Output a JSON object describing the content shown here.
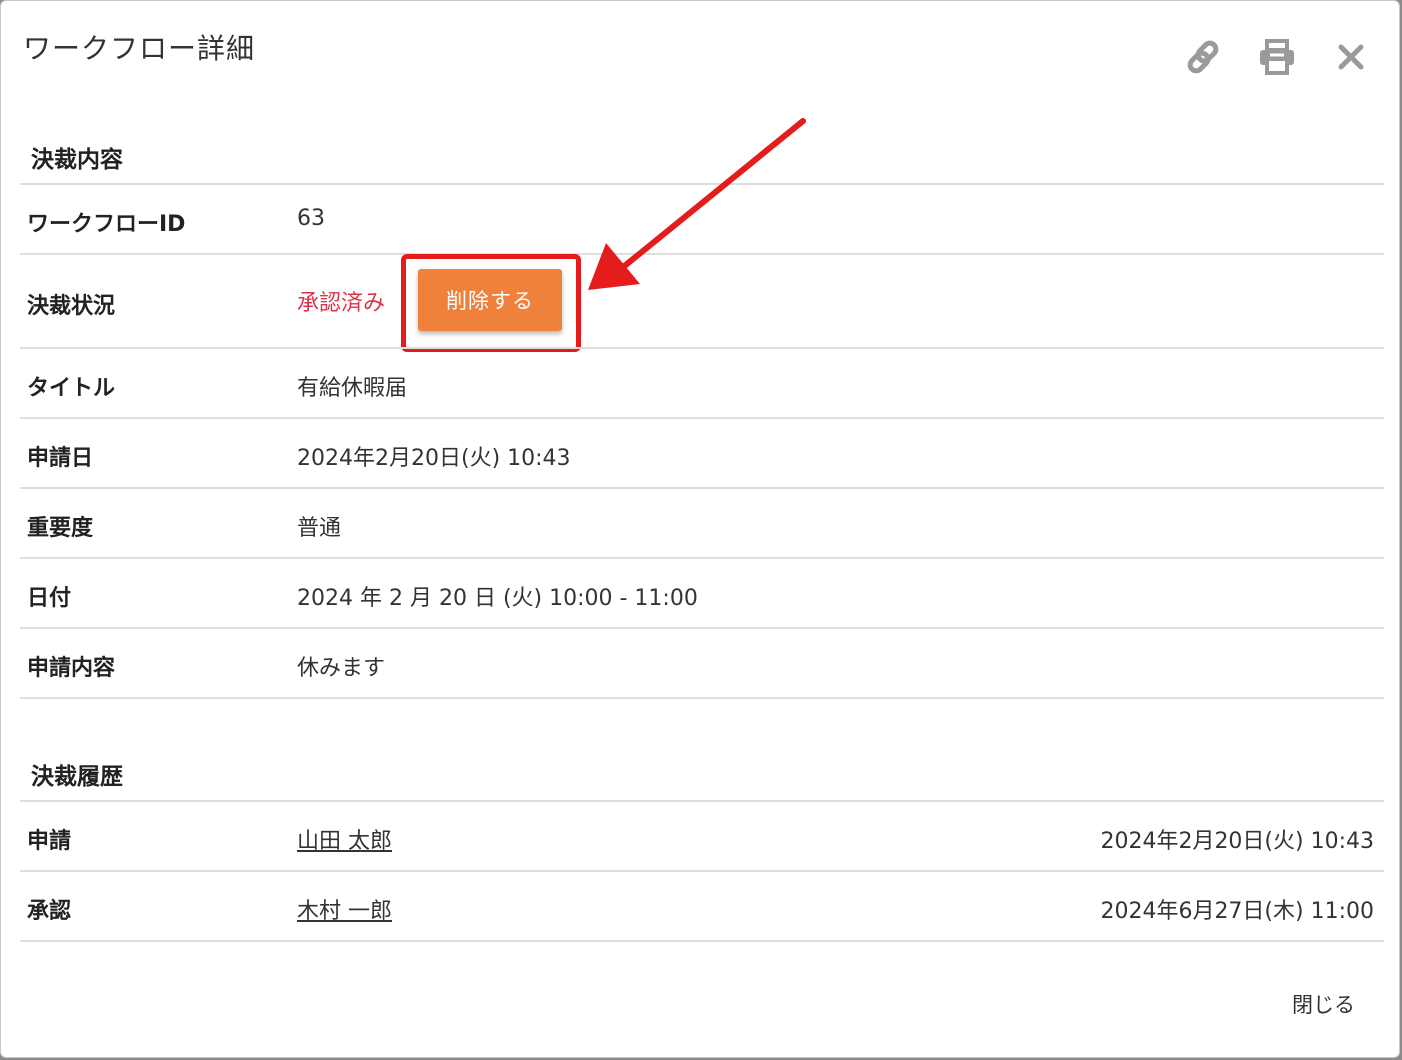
{
  "dialog": {
    "title": "ワークフロー詳細",
    "header_icons": [
      "link-icon",
      "print-icon",
      "close-icon"
    ]
  },
  "details_section": {
    "heading": "決裁内容",
    "rows": {
      "workflow_id": {
        "label": "ワークフローID",
        "value": "63"
      },
      "status": {
        "label": "決裁状況",
        "value": "承認済み",
        "delete_button": "削除する"
      },
      "title": {
        "label": "タイトル",
        "value": "有給休暇届"
      },
      "applied_date": {
        "label": "申請日",
        "value": "2024年2月20日(火) 10:43"
      },
      "importance": {
        "label": "重要度",
        "value": "普通"
      },
      "date": {
        "label": "日付",
        "value": "2024 年 2 月 20 日 (火) 10:00 - 11:00"
      },
      "content": {
        "label": "申請内容",
        "value": "休みます"
      }
    }
  },
  "history_section": {
    "heading": "決裁履歴",
    "entries": [
      {
        "action": "申請",
        "user": "山田 太郎",
        "datetime": "2024年2月20日(火) 10:43"
      },
      {
        "action": "承認",
        "user": "木村 一郎",
        "datetime": "2024年6月27日(木) 11:00"
      }
    ]
  },
  "footer": {
    "close_label": "閉じる"
  },
  "colors": {
    "delete_button": "#f0813a",
    "status_text": "#d9344b",
    "annotation": "#e41c1c"
  }
}
